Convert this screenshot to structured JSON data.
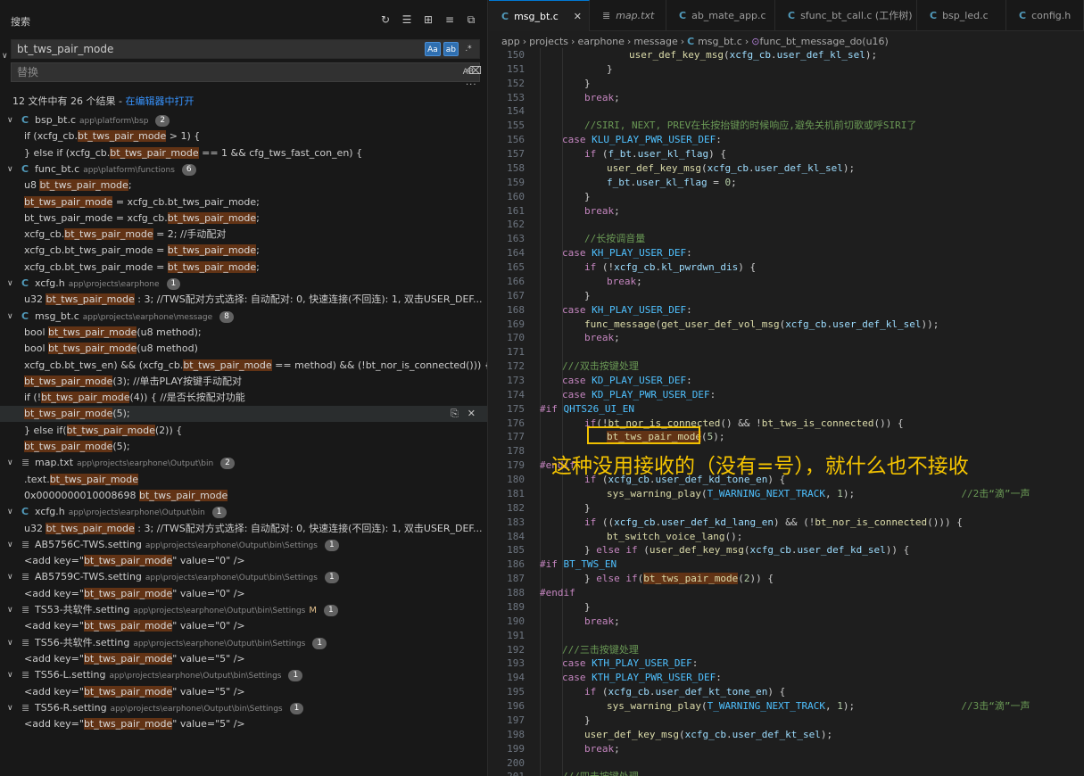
{
  "search_panel": {
    "title": "搜索",
    "query": "bt_tws_pair_mode",
    "option_case": "Aa",
    "option_word": "ab",
    "option_regex": ".*",
    "replace_placeholder": "替换",
    "replace_option": "AB",
    "summary": "12 文件中有 26 个结果 - ",
    "open_in_editor": "在编辑器中打开",
    "results": [
      {
        "kind": "file",
        "icon": "C",
        "file": "bsp_bt.c",
        "path": "app\\platform\\bsp",
        "count": "2"
      },
      {
        "kind": "match",
        "pre": "if (xcfg_cb.",
        "hit": "bt_tws_pair_mode",
        "post": " > 1) {"
      },
      {
        "kind": "match",
        "pre": "} else if (xcfg_cb.",
        "hit": "bt_tws_pair_mode",
        "post": " == 1 && cfg_tws_fast_con_en) {"
      },
      {
        "kind": "file",
        "icon": "C",
        "file": "func_bt.c",
        "path": "app\\platform\\functions",
        "count": "6"
      },
      {
        "kind": "match",
        "pre": "u8 ",
        "hit": "bt_tws_pair_mode",
        "post": ";"
      },
      {
        "kind": "match",
        "pre": "",
        "hit": "bt_tws_pair_mode",
        "post": " = xcfg_cb.bt_tws_pair_mode;"
      },
      {
        "kind": "match",
        "pre": "bt_tws_pair_mode = xcfg_cb.",
        "hit": "bt_tws_pair_mode",
        "post": ";"
      },
      {
        "kind": "match",
        "pre": "xcfg_cb.",
        "hit": "bt_tws_pair_mode",
        "post": " = 2;                                    //手动配对"
      },
      {
        "kind": "match",
        "pre": "xcfg_cb.bt_tws_pair_mode = ",
        "hit": "bt_tws_pair_mode",
        "post": ";"
      },
      {
        "kind": "match",
        "pre": "xcfg_cb.bt_tws_pair_mode = ",
        "hit": "bt_tws_pair_mode",
        "post": ";"
      },
      {
        "kind": "file",
        "icon": "C",
        "file": "xcfg.h",
        "path": "app\\projects\\earphone",
        "count": "1"
      },
      {
        "kind": "match",
        "pre": "u32 ",
        "hit": "bt_tws_pair_mode",
        "post": "                : 3;   //TWS配对方式选择: 自动配对: 0, 快速连接(不回连): 1, 双击USER_DEF..."
      },
      {
        "kind": "file",
        "icon": "C",
        "file": "msg_bt.c",
        "path": "app\\projects\\earphone\\message",
        "count": "8"
      },
      {
        "kind": "match",
        "pre": "bool ",
        "hit": "bt_tws_pair_mode",
        "post": "(u8 method);"
      },
      {
        "kind": "match",
        "pre": "bool ",
        "hit": "bt_tws_pair_mode",
        "post": "(u8 method)"
      },
      {
        "kind": "match",
        "pre": "xcfg_cb.bt_tws_en) && (xcfg_cb.",
        "hit": "bt_tws_pair_mode",
        "post": " == method) && (!bt_nor_is_connected())) {"
      },
      {
        "kind": "match",
        "pre": "",
        "hit": "bt_tws_pair_mode",
        "post": "(3);                                        //单击PLAY按键手动配对"
      },
      {
        "kind": "match",
        "pre": "if (!",
        "hit": "bt_tws_pair_mode",
        "post": "(4)) {                                  //是否长按配对功能"
      },
      {
        "kind": "match",
        "pre": "",
        "hit": "bt_tws_pair_mode",
        "post": "(5);",
        "selected": true
      },
      {
        "kind": "match",
        "pre": "} else if(",
        "hit": "bt_tws_pair_mode",
        "post": "(2)) {"
      },
      {
        "kind": "match",
        "pre": "",
        "hit": "bt_tws_pair_mode",
        "post": "(5);"
      },
      {
        "kind": "file",
        "icon": "txt",
        "file": "map.txt",
        "path": "app\\projects\\earphone\\Output\\bin",
        "count": "2"
      },
      {
        "kind": "match",
        "pre": ".text.",
        "hit": "bt_tws_pair_mode",
        "post": ""
      },
      {
        "kind": "match",
        "pre": "0x0000000010008698                ",
        "hit": "bt_tws_pair_mode",
        "post": ""
      },
      {
        "kind": "file",
        "icon": "C",
        "file": "xcfg.h",
        "path": "app\\projects\\earphone\\Output\\bin",
        "count": "1"
      },
      {
        "kind": "match",
        "pre": "u32 ",
        "hit": "bt_tws_pair_mode",
        "post": "                : 3;   //TWS配对方式选择: 自动配对: 0, 快速连接(不回连): 1, 双击USER_DEF..."
      },
      {
        "kind": "file",
        "icon": "txt",
        "file": "AB5756C-TWS.setting",
        "path": "app\\projects\\earphone\\Output\\bin\\Settings",
        "count": "1"
      },
      {
        "kind": "match",
        "pre": "<add key=\"",
        "hit": "bt_tws_pair_mode",
        "post": "\" value=\"0\" />"
      },
      {
        "kind": "file",
        "icon": "txt",
        "file": "AB5759C-TWS.setting",
        "path": "app\\projects\\earphone\\Output\\bin\\Settings",
        "count": "1"
      },
      {
        "kind": "match",
        "pre": "<add key=\"",
        "hit": "bt_tws_pair_mode",
        "post": "\" value=\"0\" />"
      },
      {
        "kind": "file",
        "icon": "txt",
        "file": "TS53-共软件.setting",
        "path": "app\\projects\\earphone\\Output\\bin\\Settings",
        "mod": "M",
        "count": "1"
      },
      {
        "kind": "match",
        "pre": "<add key=\"",
        "hit": "bt_tws_pair_mode",
        "post": "\" value=\"0\" />"
      },
      {
        "kind": "file",
        "icon": "txt",
        "file": "TS56-共软件.setting",
        "path": "app\\projects\\earphone\\Output\\bin\\Settings",
        "count": "1"
      },
      {
        "kind": "match",
        "pre": "<add key=\"",
        "hit": "bt_tws_pair_mode",
        "post": "\" value=\"5\" />"
      },
      {
        "kind": "file",
        "icon": "txt",
        "file": "TS56-L.setting",
        "path": "app\\projects\\earphone\\Output\\bin\\Settings",
        "count": "1"
      },
      {
        "kind": "match",
        "pre": "<add key=\"",
        "hit": "bt_tws_pair_mode",
        "post": "\" value=\"5\" />"
      },
      {
        "kind": "file",
        "icon": "txt",
        "file": "TS56-R.setting",
        "path": "app\\projects\\earphone\\Output\\bin\\Settings",
        "count": "1"
      },
      {
        "kind": "match",
        "pre": "<add key=\"",
        "hit": "bt_tws_pair_mode",
        "post": "\" value=\"5\" />"
      }
    ]
  },
  "tabs": [
    {
      "icon": "C",
      "label": "msg_bt.c",
      "active": true,
      "close": "✕"
    },
    {
      "icon": "txt",
      "label": "map.txt",
      "italic": true
    },
    {
      "icon": "C",
      "label": "ab_mate_app.c"
    },
    {
      "icon": "C",
      "label": "sfunc_bt_call.c (工作树)"
    },
    {
      "icon": "C",
      "label": "bsp_led.c"
    },
    {
      "icon": "C",
      "label": "config.h"
    }
  ],
  "breadcrumb": [
    "app",
    "projects",
    "earphone",
    "message",
    "msg_bt.c",
    "func_bt_message_do(u16)"
  ],
  "code_lines": [
    {
      "n": "150",
      "i": 4,
      "t": [
        [
          "user_def_key_msg",
          "fn2"
        ],
        [
          "(",
          ""
        ],
        [
          "xcfg_cb",
          "v"
        ],
        [
          ".",
          ""
        ],
        [
          "user_def_kl_sel",
          "v"
        ],
        [
          ");",
          ""
        ]
      ]
    },
    {
      "n": "151",
      "i": 3,
      "t": [
        [
          "}",
          ""
        ]
      ]
    },
    {
      "n": "152",
      "i": 2,
      "t": [
        [
          "}",
          ""
        ]
      ]
    },
    {
      "n": "153",
      "i": 2,
      "t": [
        [
          "break",
          "cf"
        ],
        [
          ";",
          ""
        ]
      ]
    },
    {
      "n": "154",
      "i": 0,
      "t": []
    },
    {
      "n": "155",
      "i": 2,
      "t": [
        [
          "//SIRI, NEXT, PREV在长按抬键的时候响应,避免关机前切歌或呼SIRI了",
          "cm"
        ]
      ]
    },
    {
      "n": "156",
      "i": 1,
      "t": [
        [
          "case ",
          "cf"
        ],
        [
          "KLU_PLAY_PWR_USER_DEF",
          "mac"
        ],
        [
          ":",
          ""
        ]
      ]
    },
    {
      "n": "157",
      "i": 2,
      "t": [
        [
          "if ",
          "cf"
        ],
        [
          "(",
          ""
        ],
        [
          "f_bt",
          "v"
        ],
        [
          ".",
          ""
        ],
        [
          "user_kl_flag",
          "v"
        ],
        [
          ") {",
          ""
        ]
      ]
    },
    {
      "n": "158",
      "i": 3,
      "t": [
        [
          "user_def_key_msg",
          "fn2"
        ],
        [
          "(",
          ""
        ],
        [
          "xcfg_cb",
          "v"
        ],
        [
          ".",
          ""
        ],
        [
          "user_def_kl_sel",
          "v"
        ],
        [
          ");",
          ""
        ]
      ]
    },
    {
      "n": "159",
      "i": 3,
      "t": [
        [
          "f_bt",
          "v"
        ],
        [
          ".",
          ""
        ],
        [
          "user_kl_flag",
          "v"
        ],
        [
          " = ",
          ""
        ],
        [
          "0",
          "n"
        ],
        [
          ";",
          ""
        ]
      ]
    },
    {
      "n": "160",
      "i": 2,
      "t": [
        [
          "}",
          ""
        ]
      ]
    },
    {
      "n": "161",
      "i": 2,
      "t": [
        [
          "break",
          "cf"
        ],
        [
          ";",
          ""
        ]
      ]
    },
    {
      "n": "162",
      "i": 0,
      "t": []
    },
    {
      "n": "163",
      "i": 2,
      "t": [
        [
          "//长按调音量",
          "cm"
        ]
      ]
    },
    {
      "n": "164",
      "i": 1,
      "t": [
        [
          "case ",
          "cf"
        ],
        [
          "KH_PLAY_USER_DEF",
          "mac"
        ],
        [
          ":",
          ""
        ]
      ]
    },
    {
      "n": "165",
      "i": 2,
      "t": [
        [
          "if ",
          "cf"
        ],
        [
          "(!",
          ""
        ],
        [
          "xcfg_cb",
          "v"
        ],
        [
          ".",
          ""
        ],
        [
          "kl_pwrdwn_dis",
          "v"
        ],
        [
          ") {",
          ""
        ]
      ]
    },
    {
      "n": "166",
      "i": 3,
      "t": [
        [
          "break",
          "cf"
        ],
        [
          ";",
          ""
        ]
      ]
    },
    {
      "n": "167",
      "i": 2,
      "t": [
        [
          "}",
          ""
        ]
      ]
    },
    {
      "n": "168",
      "i": 1,
      "t": [
        [
          "case ",
          "cf"
        ],
        [
          "KH_PLAY_USER_DEF",
          "mac"
        ],
        [
          ":",
          ""
        ]
      ]
    },
    {
      "n": "169",
      "i": 2,
      "t": [
        [
          "func_message",
          "fn2"
        ],
        [
          "(",
          ""
        ],
        [
          "get_user_def_vol_msg",
          "fn2"
        ],
        [
          "(",
          ""
        ],
        [
          "xcfg_cb",
          "v"
        ],
        [
          ".",
          ""
        ],
        [
          "user_def_kl_sel",
          "v"
        ],
        [
          "));",
          ""
        ]
      ]
    },
    {
      "n": "170",
      "i": 2,
      "t": [
        [
          "break",
          "cf"
        ],
        [
          ";",
          ""
        ]
      ]
    },
    {
      "n": "171",
      "i": 0,
      "t": []
    },
    {
      "n": "172",
      "i": 1,
      "t": [
        [
          "///双击按键处理",
          "cm"
        ]
      ]
    },
    {
      "n": "173",
      "i": 1,
      "t": [
        [
          "case ",
          "cf"
        ],
        [
          "KD_PLAY_USER_DEF",
          "mac"
        ],
        [
          ":",
          ""
        ]
      ]
    },
    {
      "n": "174",
      "i": 1,
      "t": [
        [
          "case ",
          "cf"
        ],
        [
          "KD_PLAY_PWR_USER_DEF",
          "mac"
        ],
        [
          ":",
          ""
        ]
      ]
    },
    {
      "n": "175",
      "i": 0,
      "t": [
        [
          "#if ",
          "pp"
        ],
        [
          "QHTS26_UI_EN",
          "mac"
        ]
      ]
    },
    {
      "n": "176",
      "i": 2,
      "t": [
        [
          "if",
          "cf"
        ],
        [
          "(!",
          ""
        ],
        [
          "bt_nor_is_connected",
          "fn2"
        ],
        [
          "() && !",
          ""
        ],
        [
          "bt_tws_is_connected",
          "fn2"
        ],
        [
          "()) {",
          ""
        ]
      ]
    },
    {
      "n": "177",
      "i": 3,
      "t": [
        [
          "bt_tws_pair_mode",
          "fn2 hlw"
        ],
        [
          "(",
          ""
        ],
        [
          "5",
          "n"
        ],
        [
          ");",
          ""
        ]
      ]
    },
    {
      "n": "178",
      "i": 0,
      "t": []
    },
    {
      "n": "179",
      "i": 0,
      "t": [
        [
          "#endif",
          "pp"
        ]
      ]
    },
    {
      "n": "180",
      "i": 2,
      "t": [
        [
          "if ",
          "cf"
        ],
        [
          "(",
          ""
        ],
        [
          "xcfg_cb",
          "v"
        ],
        [
          ".",
          ""
        ],
        [
          "user_def_kd_tone_en",
          "v"
        ],
        [
          ") {",
          ""
        ]
      ]
    },
    {
      "n": "181",
      "i": 3,
      "t": [
        [
          "sys_warning_play",
          "fn2"
        ],
        [
          "(",
          ""
        ],
        [
          "T_WARNING_NEXT_TRACK",
          "mac"
        ],
        [
          ", ",
          ""
        ],
        [
          "1",
          "n"
        ],
        [
          ");                  ",
          ""
        ],
        [
          "//2击“滴”一声",
          "cm"
        ]
      ]
    },
    {
      "n": "182",
      "i": 2,
      "t": [
        [
          "}",
          ""
        ]
      ]
    },
    {
      "n": "183",
      "i": 2,
      "t": [
        [
          "if ",
          "cf"
        ],
        [
          "((",
          ""
        ],
        [
          "xcfg_cb",
          "v"
        ],
        [
          ".",
          ""
        ],
        [
          "user_def_kd_lang_en",
          "v"
        ],
        [
          ") && (!",
          ""
        ],
        [
          "bt_nor_is_connected",
          "fn2"
        ],
        [
          "())) {",
          ""
        ]
      ]
    },
    {
      "n": "184",
      "i": 3,
      "t": [
        [
          "bt_switch_voice_lang",
          "fn2"
        ],
        [
          "();",
          ""
        ]
      ]
    },
    {
      "n": "185",
      "i": 2,
      "t": [
        [
          "} ",
          ""
        ],
        [
          "else if ",
          "cf"
        ],
        [
          "(",
          ""
        ],
        [
          "user_def_key_msg",
          "fn2"
        ],
        [
          "(",
          ""
        ],
        [
          "xcfg_cb",
          "v"
        ],
        [
          ".",
          ""
        ],
        [
          "user_def_kd_sel",
          "v"
        ],
        [
          ")) {",
          ""
        ]
      ]
    },
    {
      "n": "186",
      "i": 0,
      "t": [
        [
          "#if ",
          "pp"
        ],
        [
          "BT_TWS_EN",
          "mac"
        ]
      ]
    },
    {
      "n": "187",
      "i": 2,
      "t": [
        [
          "} ",
          ""
        ],
        [
          "else if",
          "cf"
        ],
        [
          "(",
          ""
        ],
        [
          "bt_tws_pair_mode",
          "fn2 hlw"
        ],
        [
          "(",
          ""
        ],
        [
          "2",
          "n"
        ],
        [
          ")) {",
          ""
        ]
      ]
    },
    {
      "n": "188",
      "i": 0,
      "t": [
        [
          "#endif",
          "pp"
        ]
      ]
    },
    {
      "n": "189",
      "i": 2,
      "t": [
        [
          "}",
          ""
        ]
      ]
    },
    {
      "n": "190",
      "i": 2,
      "t": [
        [
          "break",
          "cf"
        ],
        [
          ";",
          ""
        ]
      ]
    },
    {
      "n": "191",
      "i": 0,
      "t": []
    },
    {
      "n": "192",
      "i": 1,
      "t": [
        [
          "///三击按键处理",
          "cm"
        ]
      ]
    },
    {
      "n": "193",
      "i": 1,
      "t": [
        [
          "case ",
          "cf"
        ],
        [
          "KTH_PLAY_USER_DEF",
          "mac"
        ],
        [
          ":",
          ""
        ]
      ]
    },
    {
      "n": "194",
      "i": 1,
      "t": [
        [
          "case ",
          "cf"
        ],
        [
          "KTH_PLAY_PWR_USER_DEF",
          "mac"
        ],
        [
          ":",
          ""
        ]
      ]
    },
    {
      "n": "195",
      "i": 2,
      "t": [
        [
          "if ",
          "cf"
        ],
        [
          "(",
          ""
        ],
        [
          "xcfg_cb",
          "v"
        ],
        [
          ".",
          ""
        ],
        [
          "user_def_kt_tone_en",
          "v"
        ],
        [
          ") {",
          ""
        ]
      ]
    },
    {
      "n": "196",
      "i": 3,
      "t": [
        [
          "sys_warning_play",
          "fn2"
        ],
        [
          "(",
          ""
        ],
        [
          "T_WARNING_NEXT_TRACK",
          "mac"
        ],
        [
          ", ",
          ""
        ],
        [
          "1",
          "n"
        ],
        [
          ");                  ",
          ""
        ],
        [
          "//3击“滴”一声",
          "cm"
        ]
      ]
    },
    {
      "n": "197",
      "i": 2,
      "t": [
        [
          "}",
          ""
        ]
      ]
    },
    {
      "n": "198",
      "i": 2,
      "t": [
        [
          "user_def_key_msg",
          "fn2"
        ],
        [
          "(",
          ""
        ],
        [
          "xcfg_cb",
          "v"
        ],
        [
          ".",
          ""
        ],
        [
          "user_def_kt_sel",
          "v"
        ],
        [
          ");",
          ""
        ]
      ]
    },
    {
      "n": "199",
      "i": 2,
      "t": [
        [
          "break",
          "cf"
        ],
        [
          ";",
          ""
        ]
      ]
    },
    {
      "n": "200",
      "i": 0,
      "t": []
    },
    {
      "n": "201",
      "i": 1,
      "t": [
        [
          "///四击按键处理",
          "cm"
        ]
      ]
    }
  ],
  "annotation": "这种没用接收的（没有=号），就什么也不接收"
}
